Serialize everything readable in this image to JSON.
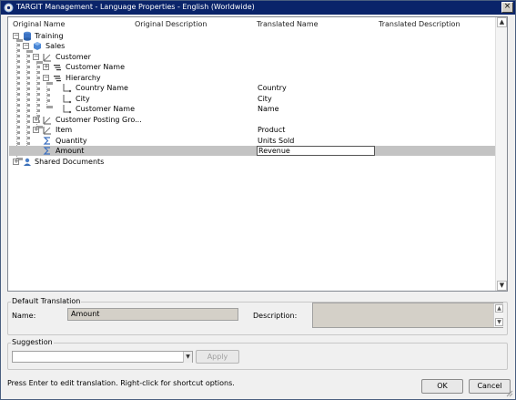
{
  "window": {
    "title": "TARGIT Management - Language Properties - English (Worldwide)",
    "close_glyph": "×"
  },
  "columns": [
    "Original Name",
    "Original Description",
    "Translated Name",
    "Translated Description"
  ],
  "tree": {
    "training": {
      "label": "Training",
      "icon": "database-icon"
    },
    "sales": {
      "label": "Sales",
      "icon": "cube-icon"
    },
    "customer": {
      "label": "Customer",
      "icon": "dimension-icon"
    },
    "customer_name_level": {
      "label": "Customer Name",
      "icon": "level-icon"
    },
    "hierarchy": {
      "label": "Hierarchy",
      "icon": "hierarchy-icon"
    },
    "country_name": {
      "label": "Country Name",
      "translated": "Country"
    },
    "city": {
      "label": "City",
      "translated": "City"
    },
    "customer_name_leaf": {
      "label": "Customer Name",
      "translated": "Name"
    },
    "customer_posting": {
      "label": "Customer Posting Gro..."
    },
    "item": {
      "label": "Item",
      "translated": "Product"
    },
    "quantity": {
      "label": "Quantity",
      "translated": "Units Sold"
    },
    "amount": {
      "label": "Amount",
      "translated": "Revenue"
    },
    "shared_documents": {
      "label": "Shared Documents"
    }
  },
  "default_translation": {
    "group_label": "Default Translation",
    "name_label": "Name:",
    "name_value": "Amount",
    "description_label": "Description:",
    "description_value": ""
  },
  "suggestion": {
    "group_label": "Suggestion",
    "value": "",
    "apply_label": "Apply"
  },
  "status_text": "Press Enter to edit translation. Right-click for shortcut options.",
  "buttons": {
    "ok": "OK",
    "cancel": "Cancel"
  },
  "glyphs": {
    "plus": "+",
    "minus": "−",
    "scroll_up": "▲",
    "scroll_down": "▼",
    "combo_arrow": "▼"
  },
  "colors": {
    "title_bar": "#0a246a",
    "selection": "#c3c3c3",
    "readonly_field": "#d4d0c8"
  }
}
